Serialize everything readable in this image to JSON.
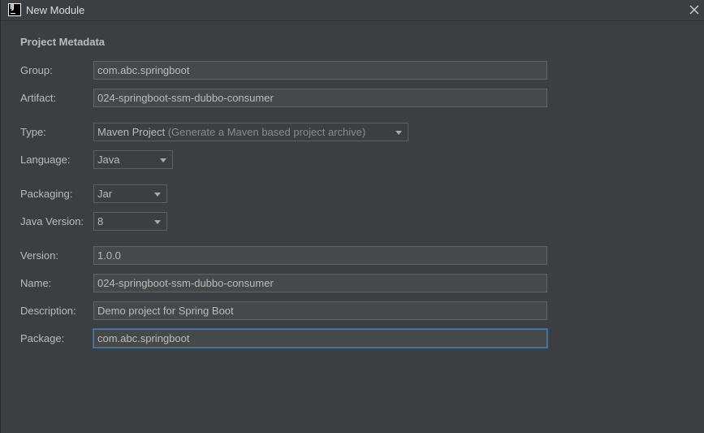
{
  "window": {
    "title": "New Module",
    "icon": "intellij-idea-icon"
  },
  "section": {
    "title": "Project Metadata"
  },
  "fields": {
    "group": {
      "label": "Group:",
      "value": "com.abc.springboot"
    },
    "artifact": {
      "label": "Artifact:",
      "value": "024-springboot-ssm-dubbo-consumer"
    },
    "type": {
      "label": "Type:",
      "value": "Maven Project",
      "hint": "(Generate a Maven based project archive)"
    },
    "language": {
      "label": "Language:",
      "value": "Java"
    },
    "packaging": {
      "label": "Packaging:",
      "value": "Jar"
    },
    "java_version": {
      "label": "Java Version:",
      "value": "8"
    },
    "version": {
      "label": "Version:",
      "value": "1.0.0"
    },
    "name": {
      "label": "Name:",
      "value": "024-springboot-ssm-dubbo-consumer"
    },
    "description": {
      "label": "Description:",
      "value": "Demo project for Spring Boot"
    },
    "package": {
      "label": "Package:",
      "value": "com.abc.springboot"
    }
  },
  "colors": {
    "background": "#3c3f41",
    "field_background": "#45494a",
    "focus_border": "#3d7bad",
    "text": "#bbbbbb"
  }
}
